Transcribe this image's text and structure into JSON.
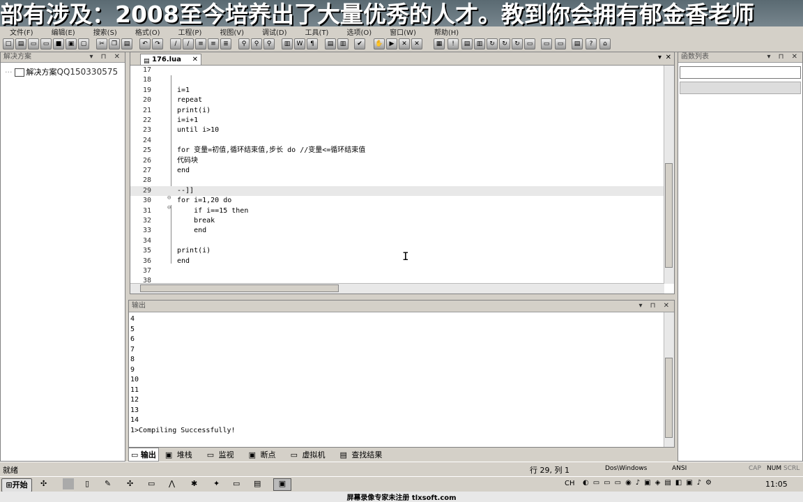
{
  "banner": {
    "text": "部有涉及：2008至今培养出了大量优秀的人才。教到你会拥有郁金香老师"
  },
  "menu": [
    "文件(F)",
    "编辑(E)",
    "搜索(S)",
    "格式(O)",
    "工程(P)",
    "视图(V)",
    "调试(D)",
    "工具(T)",
    "选项(O)",
    "窗口(W)",
    "帮助(H)"
  ],
  "left_panel": {
    "title": "解决方案",
    "item": "解决方案",
    "qq": "QQ150330575"
  },
  "right_panel": {
    "title": "函数列表"
  },
  "editor": {
    "tab": "176.lua",
    "lines": [
      {
        "n": "17",
        "t": ""
      },
      {
        "n": "18",
        "t": ""
      },
      {
        "n": "19",
        "t": "i=1"
      },
      {
        "n": "20",
        "t": "repeat"
      },
      {
        "n": "21",
        "t": "print(i)"
      },
      {
        "n": "22",
        "t": "i=i+1"
      },
      {
        "n": "23",
        "t": "until i>10"
      },
      {
        "n": "24",
        "t": ""
      },
      {
        "n": "25",
        "t": "for 变量=初值,循环结束值,步长 do //变量<=循环结束值"
      },
      {
        "n": "26",
        "t": "代码块"
      },
      {
        "n": "27",
        "t": "end"
      },
      {
        "n": "28",
        "t": ""
      },
      {
        "n": "29",
        "t": "--]]"
      },
      {
        "n": "30",
        "t": "for i=1,20 do"
      },
      {
        "n": "31",
        "t": "    if i==15 then"
      },
      {
        "n": "32",
        "t": "    break"
      },
      {
        "n": "33",
        "t": "    end"
      },
      {
        "n": "34",
        "t": ""
      },
      {
        "n": "35",
        "t": "print(i)"
      },
      {
        "n": "36",
        "t": "end"
      },
      {
        "n": "37",
        "t": ""
      },
      {
        "n": "38",
        "t": ""
      }
    ]
  },
  "output": {
    "title": "输出",
    "lines": [
      "4",
      "5",
      "6",
      "7",
      "8",
      "9",
      "10",
      "11",
      "12",
      "13",
      "14",
      "1>Compiling Successfully!"
    ]
  },
  "output_tabs": [
    "输出",
    "堆栈",
    "监视",
    "断点",
    "虚拟机",
    "查找结果"
  ],
  "status": {
    "left": "就绪",
    "position": "行 29, 列 1",
    "format": "Dos\\Windows",
    "encoding": "ANSI",
    "caps": "CAP",
    "num": "NUM",
    "scrl": "SCRL"
  },
  "taskbar": {
    "start": "开始",
    "lang": "CH",
    "clock": "11:05"
  },
  "watermark": "屏幕录像专家未注册 tlxsoft.com"
}
